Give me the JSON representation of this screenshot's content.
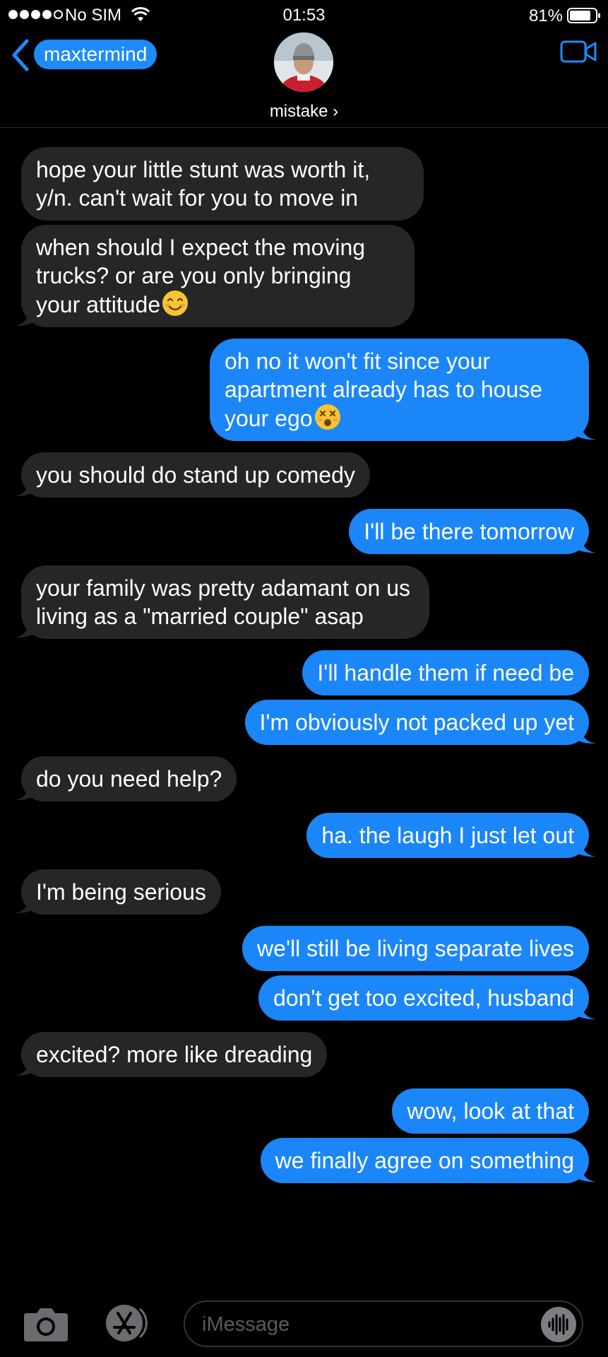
{
  "status_bar": {
    "carrier": "No SIM",
    "time": "01:53",
    "battery": "81%"
  },
  "header": {
    "back_label": "maxtermind",
    "contact_name": "mistake ›"
  },
  "messages": [
    {
      "side": "left",
      "text": "hope your little stunt was worth it, y/n. can't wait for you to move in",
      "tail": false,
      "gap": false
    },
    {
      "side": "left",
      "text": "when should I expect the moving trucks? or are you only bringing your attitude",
      "emoji": "smiling-face",
      "tail": true,
      "gap": false
    },
    {
      "side": "right",
      "text": "oh no it won't fit since your apartment already has to house your ego",
      "emoji": "dizzy-face",
      "tail": true,
      "gap": true
    },
    {
      "side": "left",
      "text": "you should do stand up comedy",
      "tail": true,
      "gap": true
    },
    {
      "side": "right",
      "text": "I'll be there tomorrow",
      "tail": true,
      "gap": true
    },
    {
      "side": "left",
      "text": "your family was pretty adamant on us living as a \"married couple\" asap",
      "tail": true,
      "gap": true
    },
    {
      "side": "right",
      "text": "I'll handle them if need be",
      "tail": false,
      "gap": true
    },
    {
      "side": "right",
      "text": "I'm obviously not packed up yet",
      "tail": true,
      "gap": false
    },
    {
      "side": "left",
      "text": "do you need help?",
      "tail": true,
      "gap": true
    },
    {
      "side": "right",
      "text": "ha. the laugh I just let out",
      "tail": true,
      "gap": true
    },
    {
      "side": "left",
      "text": "I'm being serious",
      "tail": true,
      "gap": true
    },
    {
      "side": "right",
      "text": "we'll still be living separate lives",
      "tail": false,
      "gap": true
    },
    {
      "side": "right",
      "text": "don't get too excited, husband",
      "tail": true,
      "gap": false
    },
    {
      "side": "left",
      "text": "excited? more like dreading",
      "tail": true,
      "gap": true
    },
    {
      "side": "right",
      "text": "wow, look at that",
      "tail": false,
      "gap": true
    },
    {
      "side": "right",
      "text": "we finally agree on something",
      "tail": true,
      "gap": false
    }
  ],
  "input": {
    "placeholder": "iMessage"
  },
  "colors": {
    "incoming_bubble": "#262628",
    "outgoing_bubble": "#1b86f8",
    "accent": "#1e8bfa"
  },
  "icons": [
    "wifi-icon",
    "battery-icon",
    "back-chevron-icon",
    "video-camera-icon",
    "camera-icon",
    "app-store-icon",
    "audio-waveform-icon"
  ]
}
